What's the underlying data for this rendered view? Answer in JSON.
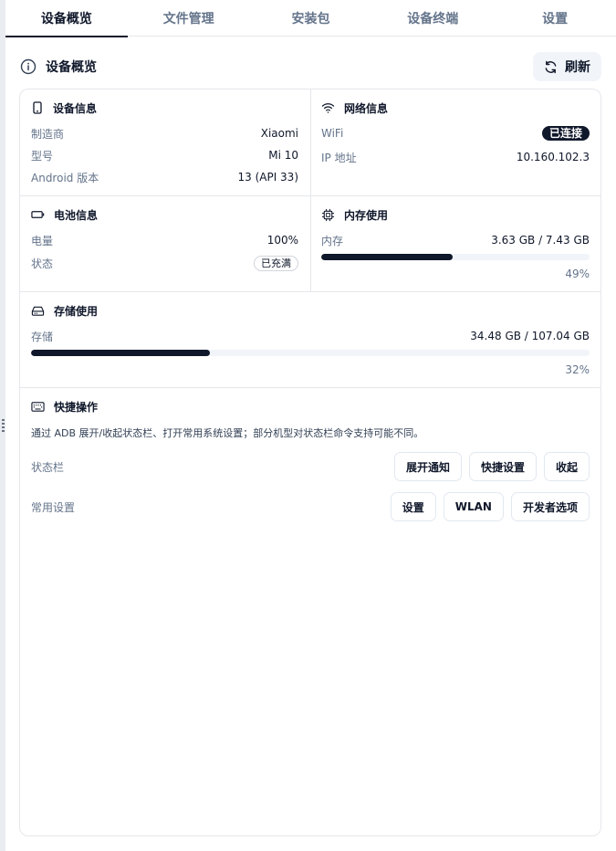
{
  "tabs": [
    "设备概览",
    "文件管理",
    "安装包",
    "设备终端",
    "设置"
  ],
  "header": {
    "title": "设备概览",
    "refresh_label": "刷新"
  },
  "device_info": {
    "title": "设备信息",
    "rows": [
      {
        "key": "制造商",
        "value": "Xiaomi"
      },
      {
        "key": "型号",
        "value": "Mi 10"
      },
      {
        "key": "Android 版本",
        "value": "13 (API 33)"
      }
    ]
  },
  "network_info": {
    "title": "网络信息",
    "wifi_label": "WiFi",
    "wifi_status": "已连接",
    "ip_label": "IP 地址",
    "ip_value": "10.160.102.3"
  },
  "battery_info": {
    "title": "电池信息",
    "level_label": "电量",
    "level_value": "100%",
    "status_label": "状态",
    "status_value": "已充满"
  },
  "memory": {
    "title": "内存使用",
    "label": "内存",
    "value": "3.63 GB / 7.43 GB",
    "percent_text": "49%",
    "percent": 49
  },
  "storage": {
    "title": "存储使用",
    "label": "存储",
    "value": "34.48 GB / 107.04 GB",
    "percent_text": "32%",
    "percent": 32
  },
  "quick_actions": {
    "title": "快捷操作",
    "description": "通过 ADB 展开/收起状态栏、打开常用系统设置；部分机型对状态栏命令支持可能不同。",
    "status_bar_label": "状态栏",
    "status_bar_buttons": [
      "展开通知",
      "快捷设置",
      "收起"
    ],
    "settings_label": "常用设置",
    "settings_buttons": [
      "设置",
      "WLAN",
      "开发者选项"
    ]
  }
}
